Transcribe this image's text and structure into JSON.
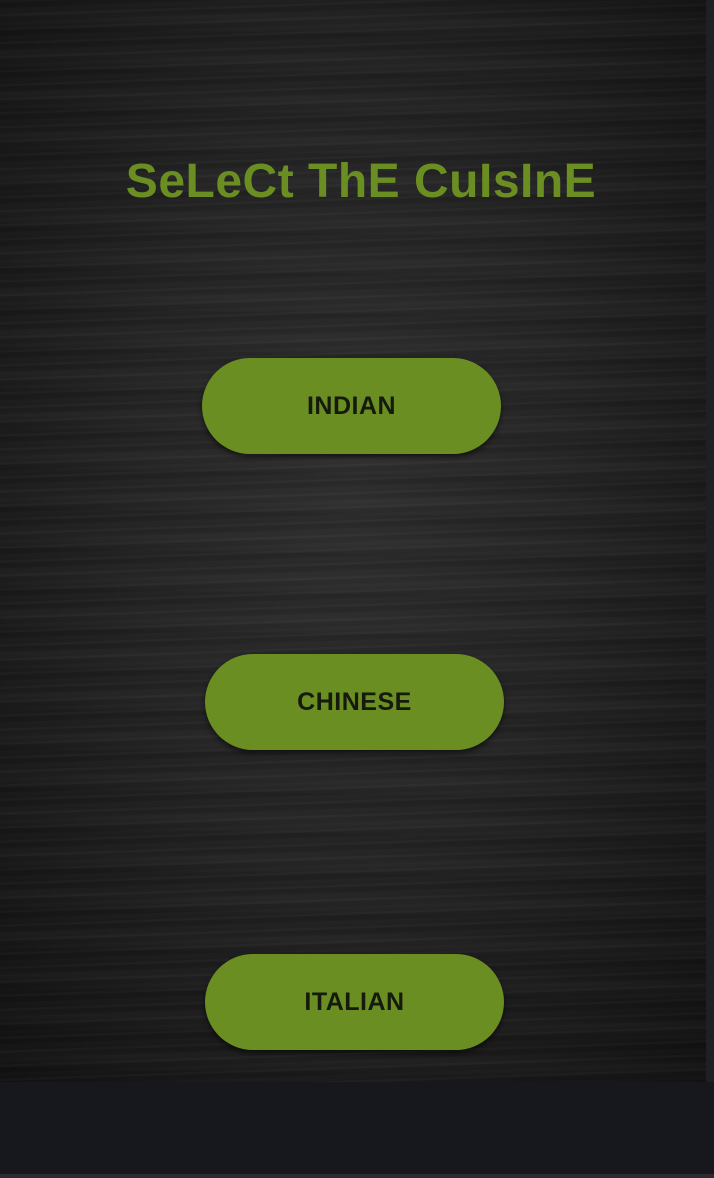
{
  "screen": {
    "title": "SeLeCt ThE CuIsInE",
    "accent_color": "#6b8e23",
    "background_color": "#222222"
  },
  "buttons": [
    {
      "label": "INDIAN"
    },
    {
      "label": "CHINESE"
    },
    {
      "label": "ITALIAN"
    }
  ]
}
